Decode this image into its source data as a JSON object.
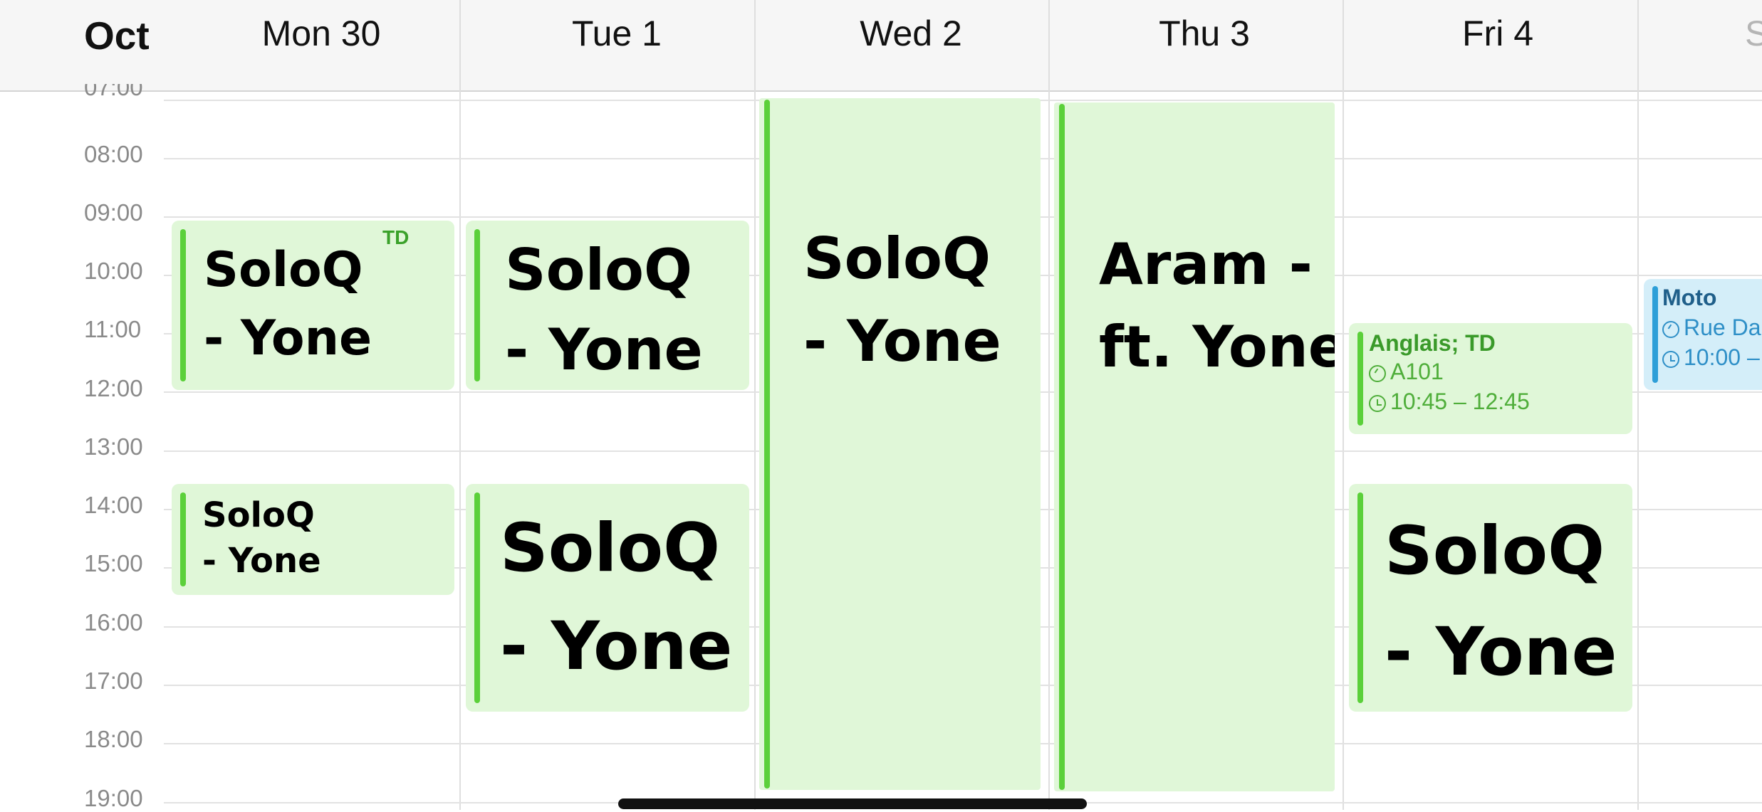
{
  "header": {
    "month": "Oct",
    "days": [
      "Mon 30",
      "Tue 1",
      "Wed 2",
      "Thu 3",
      "Fri 4",
      "S"
    ]
  },
  "time_labels": [
    "07:00",
    "08:00",
    "09:00",
    "10:00",
    "11:00",
    "12:00",
    "13:00",
    "14:00",
    "15:00",
    "16:00",
    "17:00",
    "18:00",
    "19:00"
  ],
  "events": {
    "mon_morning": {
      "line1": "SoloQ",
      "line2": "- Yone",
      "stray": "TD"
    },
    "mon_afternoon": {
      "line1": "SoloQ",
      "line2": "- Yone"
    },
    "tue_morning": {
      "line1": "SoloQ",
      "line2": "- Yone"
    },
    "tue_afternoon": {
      "line1": "SoloQ",
      "line2": "- Yone"
    },
    "wed_allday": {
      "line1": "SoloQ",
      "line2": "- Yone"
    },
    "thu_allday": {
      "line1": "Aram -",
      "line2": "ft. Yone"
    },
    "fri_anglais": {
      "title": "Anglais; TD",
      "location": "A101",
      "time": "10:45 – 12:45"
    },
    "fri_afternoon": {
      "line1": "SoloQ",
      "line2": "- Yone"
    },
    "sat_moto": {
      "title": "Moto",
      "location": "Rue Da",
      "time": "10:00 –"
    }
  },
  "colors": {
    "event_green_bg": "#e0f7d8",
    "event_green_bar": "#5bd03a",
    "event_blue_bg": "#d4eef9",
    "event_blue_bar": "#2e9fd8"
  }
}
